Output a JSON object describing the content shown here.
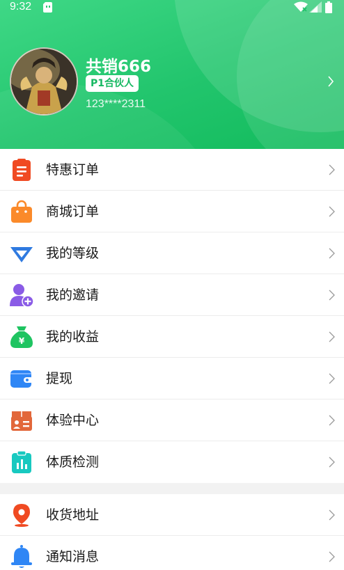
{
  "status_bar": {
    "time": "9:32"
  },
  "profile": {
    "name": "共销666",
    "level_badge": "P1合伙人",
    "phone": "123****2311"
  },
  "menu_group_1": [
    {
      "label": "特惠订单",
      "icon": "clipboard-list-icon",
      "color": "#f04a22"
    },
    {
      "label": "商城订单",
      "icon": "shopping-bag-icon",
      "color": "#fb8a2a"
    },
    {
      "label": "我的等级",
      "icon": "diamond-icon",
      "color": "#2f7ae0"
    },
    {
      "label": "我的邀请",
      "icon": "add-user-icon",
      "color": "#8a5be6"
    },
    {
      "label": "我的收益",
      "icon": "money-bag-icon",
      "color": "#1fc461"
    },
    {
      "label": "提现",
      "icon": "wallet-icon",
      "color": "#2f86f5"
    },
    {
      "label": "体验中心",
      "icon": "experience-box-icon",
      "color": "#e2673a"
    },
    {
      "label": "体质检测",
      "icon": "health-check-icon",
      "color": "#18c9c0"
    }
  ],
  "menu_group_2": [
    {
      "label": "收货地址",
      "icon": "location-pin-icon",
      "color": "#f04a22"
    },
    {
      "label": "通知消息",
      "icon": "bell-icon",
      "color": "#2f86f5"
    }
  ]
}
